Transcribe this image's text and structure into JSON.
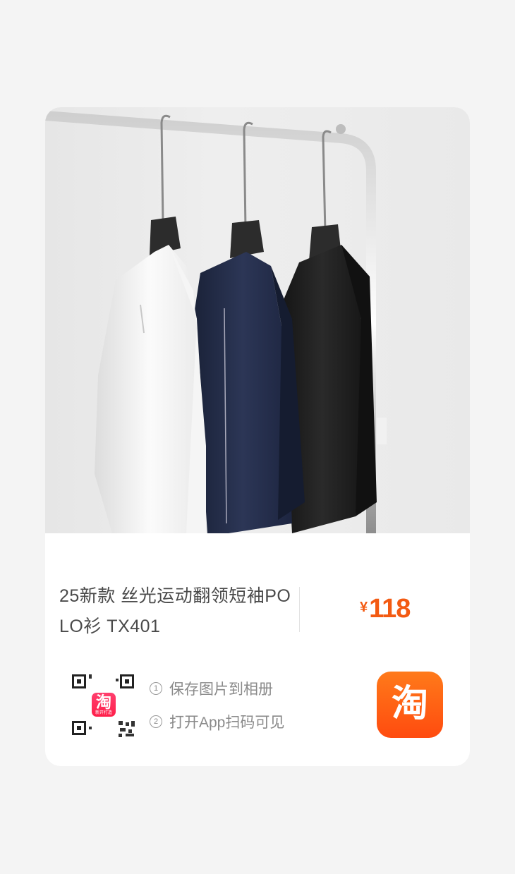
{
  "product": {
    "title": "25新款 丝光运动翻领短袖POLO衫 TX401",
    "price_currency": "¥",
    "price_value": "118"
  },
  "qr": {
    "logo_char": "淘",
    "logo_caption": "新开打造"
  },
  "steps": [
    {
      "num": "1",
      "text": "保存图片到相册"
    },
    {
      "num": "2",
      "text": "打开App扫码可见"
    }
  ],
  "app_icon": {
    "char": "淘"
  },
  "colors": {
    "price": "#f35a12",
    "taobao_orange": "#ff5a12",
    "background": "#f4f4f4"
  }
}
